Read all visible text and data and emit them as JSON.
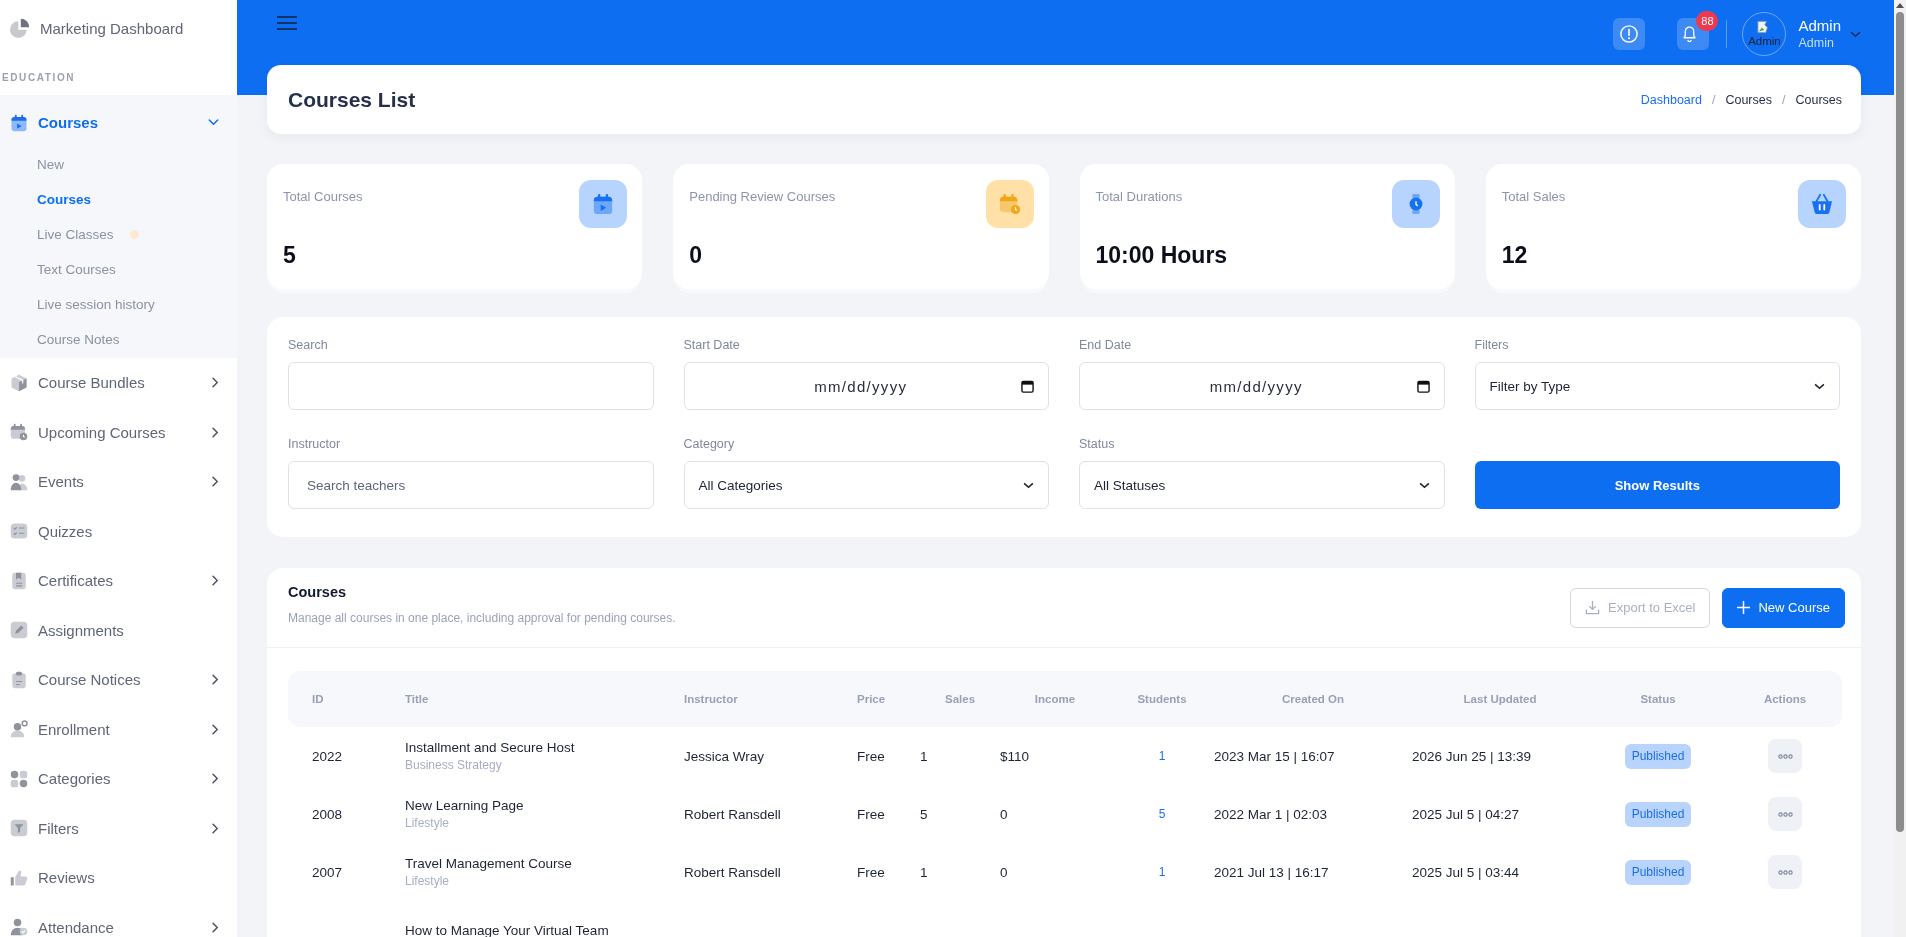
{
  "sidebar": {
    "top_item": {
      "label": "Marketing Dashboard",
      "selected": false
    },
    "section_heading": "EDUCATION",
    "items": [
      {
        "label": "Courses",
        "kind": "group",
        "expanded": true,
        "selected": true,
        "children": [
          {
            "label": "New",
            "selected": false,
            "dot": false
          },
          {
            "label": "Courses",
            "selected": true,
            "dot": false
          },
          {
            "label": "Live Classes",
            "selected": false,
            "dot": true
          },
          {
            "label": "Text Courses",
            "selected": false,
            "dot": false
          },
          {
            "label": "Live session history",
            "selected": false,
            "dot": false
          },
          {
            "label": "Course Notes",
            "selected": false,
            "dot": false
          }
        ]
      },
      {
        "label": "Course Bundles",
        "kind": "group",
        "expanded": false,
        "selected": false
      },
      {
        "label": "Upcoming Courses",
        "kind": "group",
        "expanded": false,
        "selected": false
      },
      {
        "label": "Events",
        "kind": "group",
        "expanded": false,
        "selected": false
      },
      {
        "label": "Quizzes",
        "kind": "link",
        "selected": false
      },
      {
        "label": "Certificates",
        "kind": "group",
        "expanded": false,
        "selected": false
      },
      {
        "label": "Assignments",
        "kind": "link",
        "selected": false
      },
      {
        "label": "Course Notices",
        "kind": "group",
        "expanded": false,
        "selected": false
      },
      {
        "label": "Enrollment",
        "kind": "group",
        "expanded": false,
        "selected": false
      },
      {
        "label": "Categories",
        "kind": "group",
        "expanded": false,
        "selected": false
      },
      {
        "label": "Filters",
        "kind": "group",
        "expanded": false,
        "selected": false
      },
      {
        "label": "Reviews",
        "kind": "link",
        "selected": false
      },
      {
        "label": "Attendance",
        "kind": "group",
        "expanded": false,
        "selected": false
      }
    ]
  },
  "top_bar": {
    "notifications_badge": "88",
    "user": {
      "avatar_alt": "Admin",
      "name": "Admin",
      "role": "Admin"
    }
  },
  "page_header": {
    "title": "Courses List",
    "breadcrumbs": [
      {
        "kind": "link",
        "label": "Dashboard"
      },
      {
        "kind": "separator",
        "label": "/"
      },
      {
        "kind": "text",
        "label": "Courses"
      },
      {
        "kind": "separator",
        "label": "/"
      },
      {
        "kind": "text",
        "label": "Courses"
      }
    ]
  },
  "stats": [
    {
      "label": "Total Courses",
      "value": "5",
      "color": "#b6d4fd"
    },
    {
      "label": "Pending Review Courses",
      "value": "0",
      "color": "#ffe0a6"
    },
    {
      "label": "Total Durations",
      "value": "10:00 Hours",
      "color": "#b6d4fd"
    },
    {
      "label": "Total Sales",
      "value": "12",
      "color": "#b6d4fd"
    }
  ],
  "filters": {
    "fields": [
      {
        "kind": "text",
        "label": "Search"
      },
      {
        "kind": "date",
        "label": "Start Date",
        "placeholder": "mm/dd/yyyy"
      },
      {
        "kind": "date",
        "label": "End Date",
        "placeholder": "mm/dd/yyyy"
      },
      {
        "kind": "select",
        "label": "Filters",
        "value": "Filter by Type"
      },
      {
        "kind": "text",
        "label": "Instructor",
        "placeholder": "Search teachers"
      },
      {
        "kind": "select",
        "label": "Category",
        "value": "All Categories"
      },
      {
        "kind": "select",
        "label": "Status",
        "value": "All Statuses"
      }
    ],
    "submit_button": "Show Results"
  },
  "courses_table": {
    "title": "Courses",
    "subtitle": "Manage all courses in one place, including approval for pending courses.",
    "buttons": [
      {
        "kind": "outline",
        "label": "Export to Excel",
        "disabled": true
      },
      {
        "kind": "primary",
        "label": "New Course",
        "disabled": false
      }
    ],
    "columns": [
      "ID",
      "Title",
      "Instructor",
      "Price",
      "Sales",
      "Income",
      "Students",
      "Created On",
      "Last Updated",
      "Status",
      "Actions"
    ],
    "rows": [
      {
        "id": "2022",
        "title": "Installment and Secure Host",
        "category": "Business Strategy",
        "instructor": "Jessica Wray",
        "price": "Free",
        "sales": "1",
        "income": "$110",
        "students": "1",
        "created_on": "2023 Mar 15 | 16:07",
        "last_updated": "2026 Jun 25 | 13:39",
        "status": "Published"
      },
      {
        "id": "2008",
        "title": "New Learning Page",
        "category": "Lifestyle",
        "instructor": "Robert Ransdell",
        "price": "Free",
        "sales": "5",
        "income": "0",
        "students": "5",
        "created_on": "2022 Mar 1 | 02:03",
        "last_updated": "2025 Jul 5 | 04:27",
        "status": "Published"
      },
      {
        "id": "2007",
        "title": "Travel Management Course",
        "category": "Lifestyle",
        "instructor": "Robert Ransdell",
        "price": "Free",
        "sales": "1",
        "income": "0",
        "students": "1",
        "created_on": "2021 Jul 13 | 16:17",
        "last_updated": "2025 Jul 5 | 03:44",
        "status": "Published"
      },
      {
        "title": "How to Manage Your Virtual Team"
      }
    ]
  }
}
